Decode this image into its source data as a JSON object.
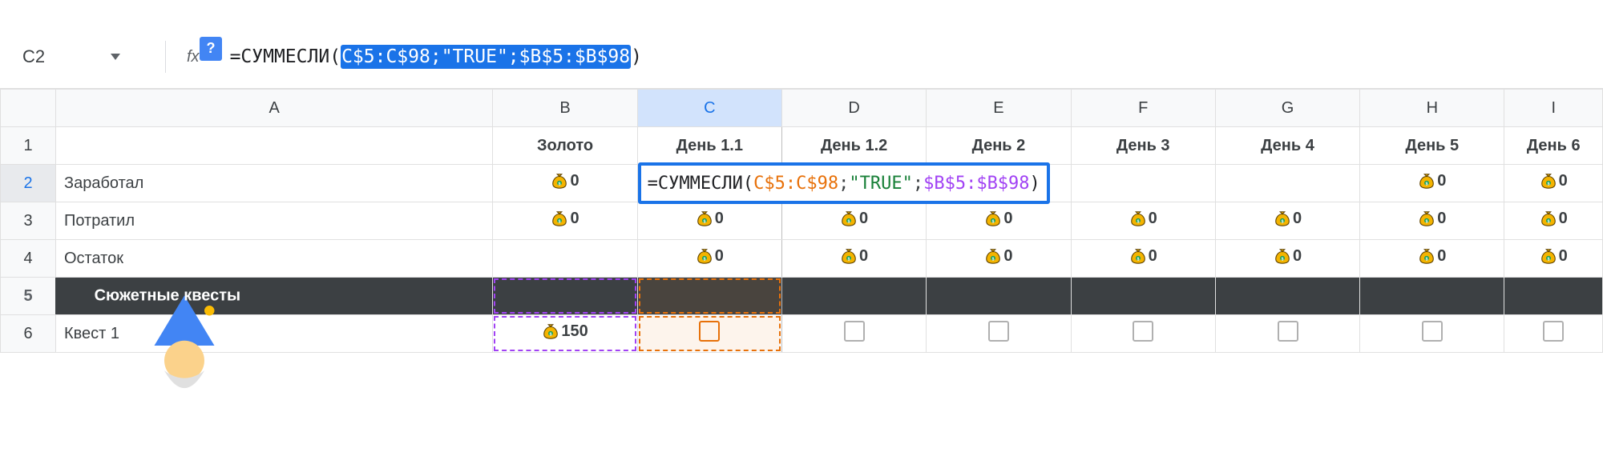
{
  "cellRef": "C2",
  "fx": "fx",
  "helpGlyph": "?",
  "formula": {
    "eq": "=",
    "fn": "СУММЕСЛИ",
    "open": "(",
    "arg1": "C$5:C$98",
    "sep1": ";",
    "arg2": "\"TRUE\"",
    "sep2": ";",
    "arg3": "$B$5:$B$98",
    "close": ")"
  },
  "columns": [
    "A",
    "B",
    "C",
    "D",
    "E",
    "F",
    "G",
    "H",
    "I"
  ],
  "colHeaders": {
    "A": "",
    "B": "Золото",
    "C": "День 1.1",
    "D": "День 1.2",
    "E": "День 2",
    "F": "День 3",
    "G": "День 4",
    "H": "День 5",
    "I": "День 6"
  },
  "rows": {
    "r1": "1",
    "r2": "2",
    "r3": "3",
    "r4": "4",
    "r5": "5",
    "r6": "6"
  },
  "labels": {
    "earned": "Заработал",
    "spent": "Потратил",
    "balance": "Остаток",
    "storyQuests": "Сюжетные квесты",
    "quest1": "Квест 1"
  },
  "zero": "0",
  "q1gold": "150"
}
